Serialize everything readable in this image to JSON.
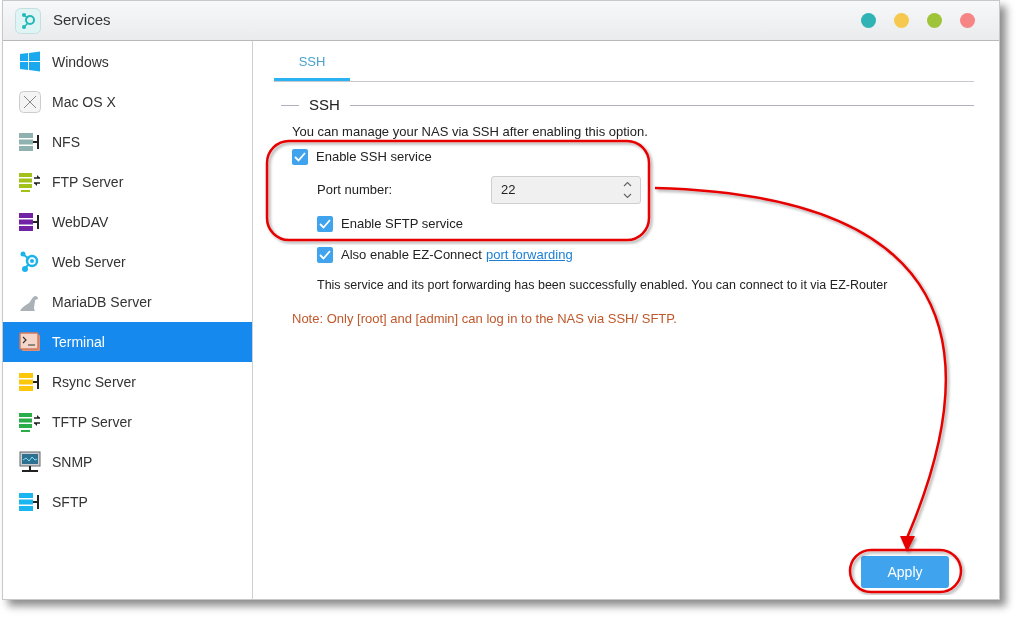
{
  "window": {
    "title": "Services"
  },
  "sidebar": {
    "items": [
      {
        "label": "Windows",
        "selected": false
      },
      {
        "label": "Mac OS X",
        "selected": false
      },
      {
        "label": "NFS",
        "selected": false
      },
      {
        "label": "FTP Server",
        "selected": false
      },
      {
        "label": "WebDAV",
        "selected": false
      },
      {
        "label": "Web Server",
        "selected": false
      },
      {
        "label": "MariaDB Server",
        "selected": false
      },
      {
        "label": "Terminal",
        "selected": true
      },
      {
        "label": "Rsync Server",
        "selected": false
      },
      {
        "label": "TFTP Server",
        "selected": false
      },
      {
        "label": "SNMP",
        "selected": false
      },
      {
        "label": "SFTP",
        "selected": false
      }
    ]
  },
  "tabs": [
    {
      "label": "SSH",
      "selected": true
    }
  ],
  "section": {
    "title": "SSH",
    "description": "You can manage your NAS via SSH after enabling this option.",
    "options": [
      {
        "kind": "checkbox",
        "label": "Enable SSH service",
        "checked": true,
        "children": [
          {
            "kind": "number",
            "label": "Port number:",
            "value": "22"
          },
          {
            "kind": "checkbox",
            "label": "Enable SFTP service",
            "checked": true
          },
          {
            "kind": "checkbox",
            "label": "Also enable EZ-Connect",
            "link": "port forwarding",
            "checked": true
          },
          {
            "kind": "text",
            "text": "This service and its port forwarding has been successfully enabled. You can connect to it via EZ-Router"
          }
        ]
      }
    ],
    "note": "Note: Only [root] and [admin] can log in to the NAS via SSH/ SFTP."
  },
  "buttons": [
    {
      "label": "Apply"
    }
  ]
}
